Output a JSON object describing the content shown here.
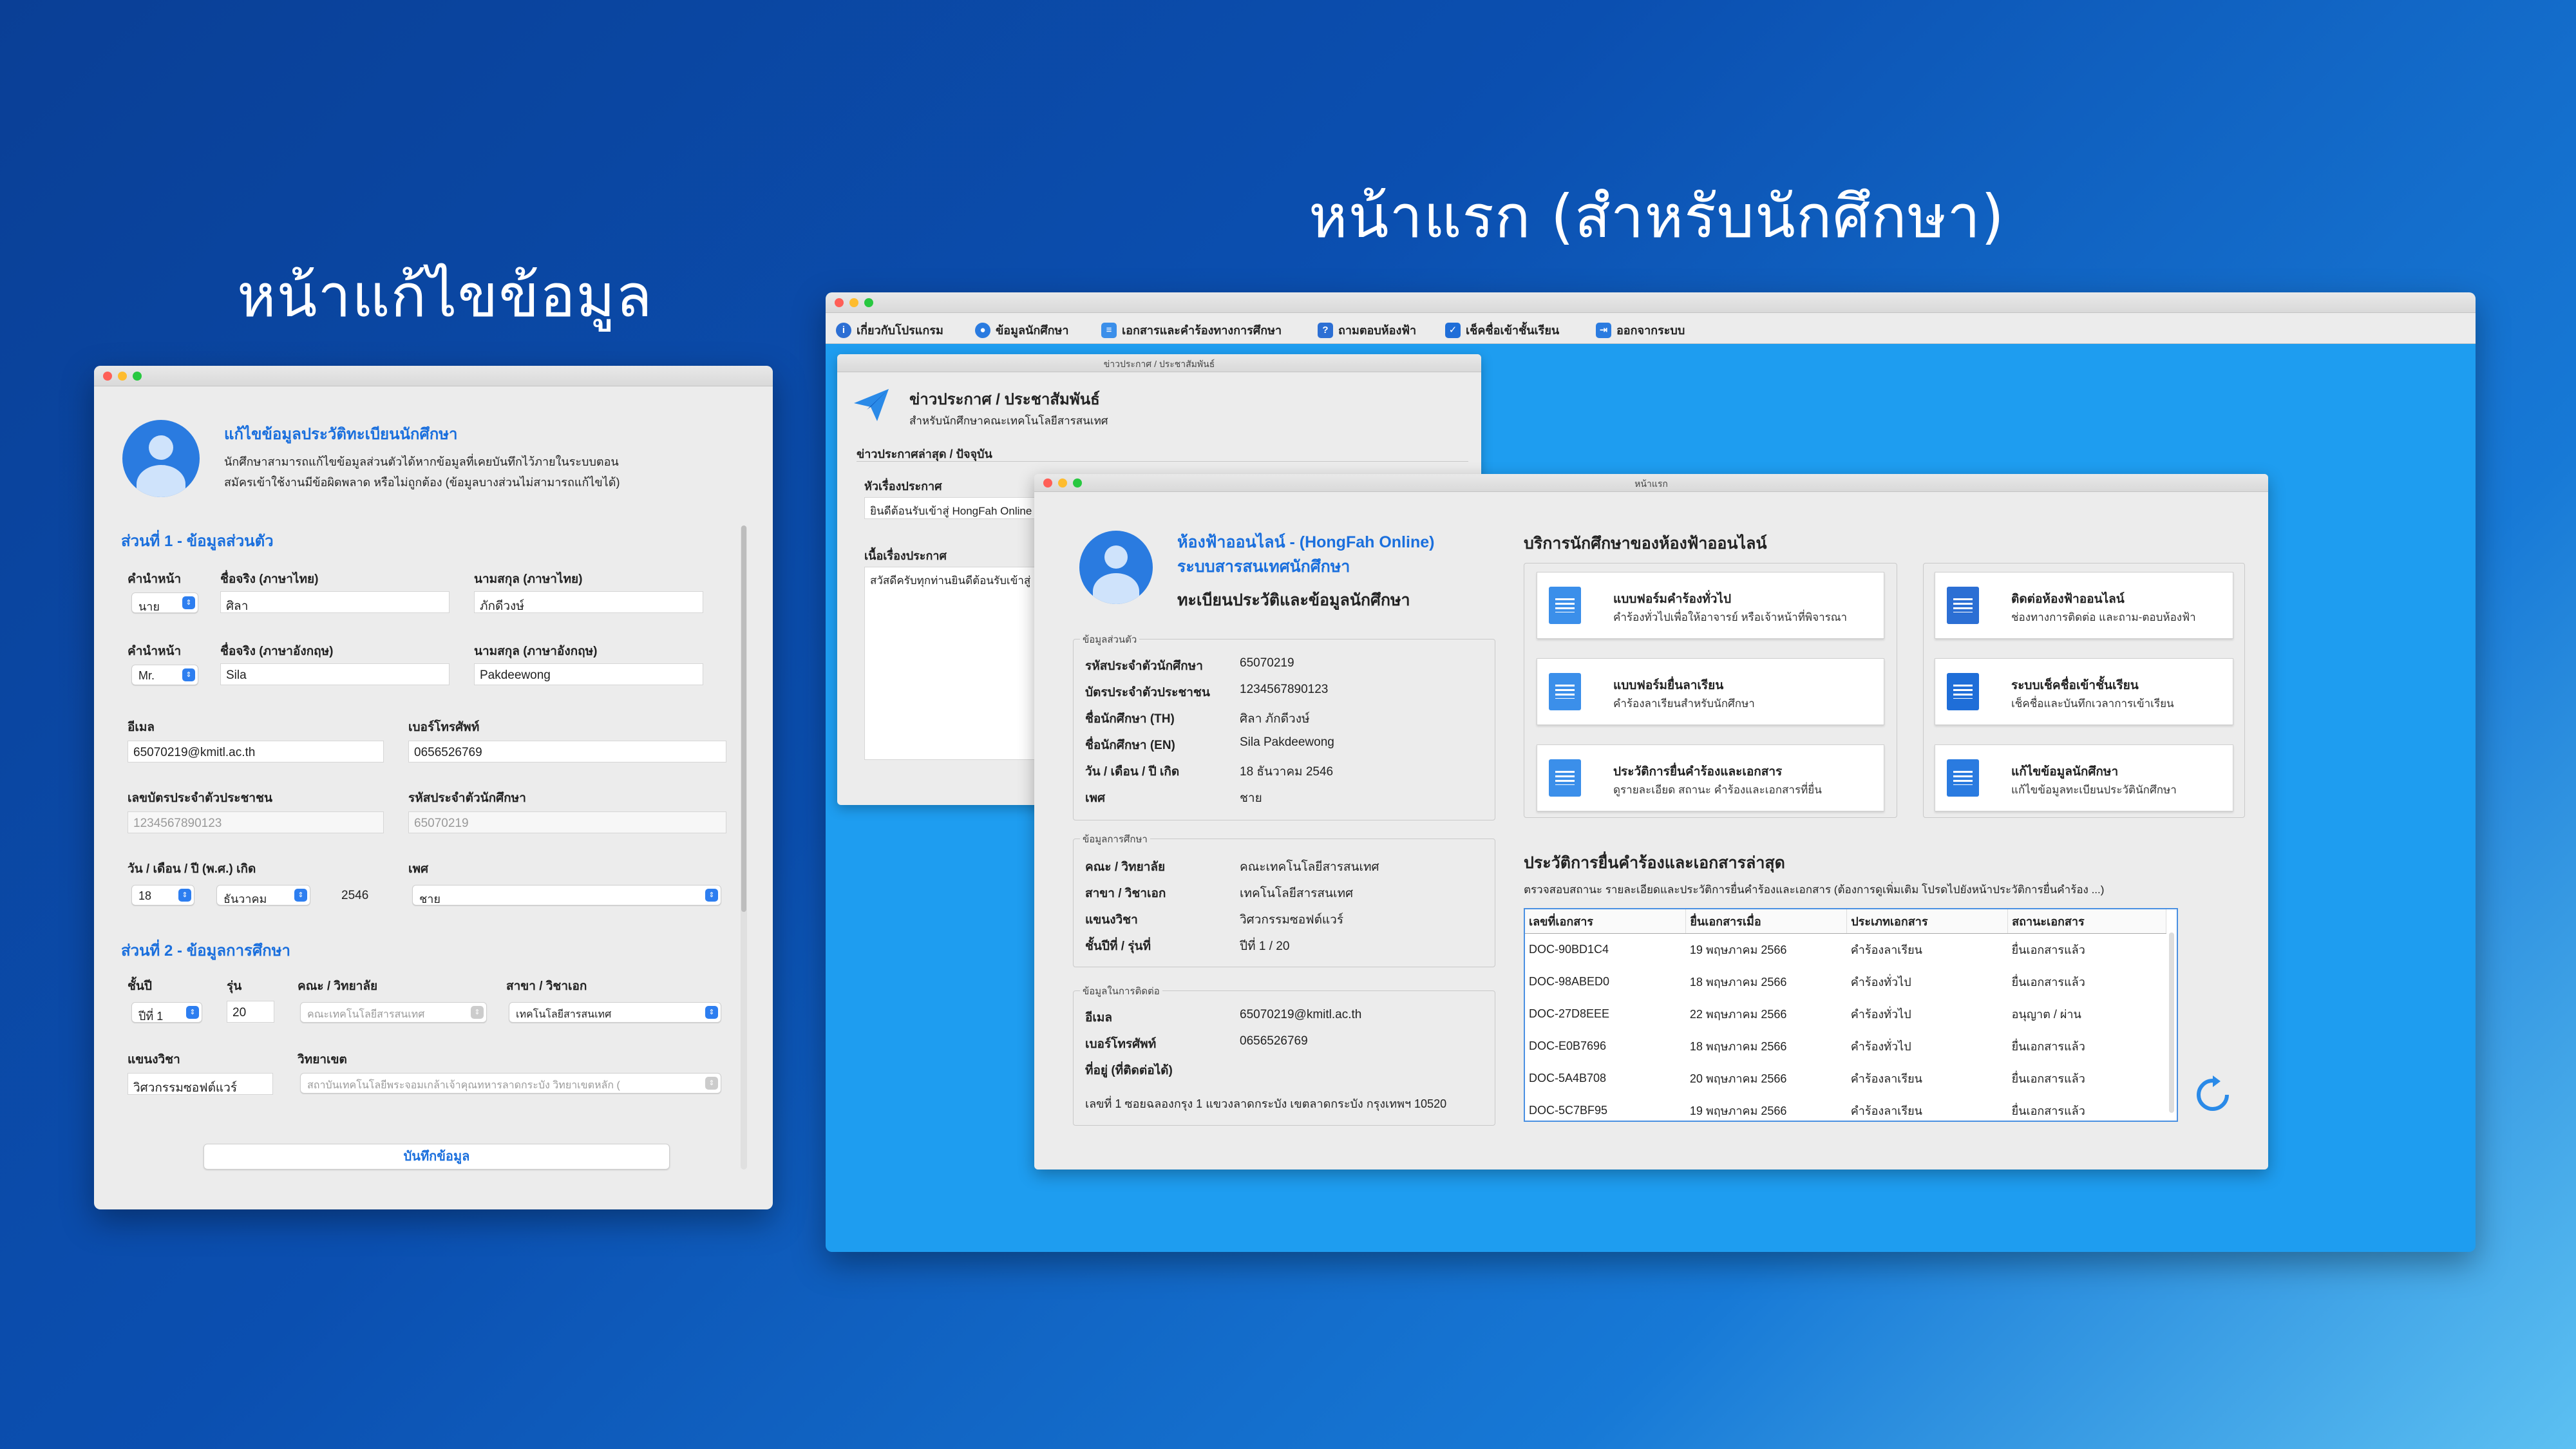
{
  "headings": {
    "edit": "หน้าแก้ไขข้อมูล",
    "home": "หน้าแรก (สำหรับนักศึกษา)"
  },
  "edit": {
    "title": "แก้ไขข้อมูลประวัติทะเบียนนักศึกษา",
    "desc1": "นักศึกษาสามารถแก้ไขข้อมูลส่วนตัวได้หากข้อมูลที่เคยบันทึกไว้ภายในระบบตอน",
    "desc2": "สมัครเข้าใช้งานมีข้อผิดพลาด หรือไม่ถูกต้อง (ข้อมูลบางส่วนไม่สามารถแก้ไขได้)",
    "sec1": "ส่วนที่ 1 - ข้อมูลส่วนตัว",
    "prefix_th_label": "คำนำหน้า",
    "prefix_th": "นาย",
    "fname_th_label": "ชื่อจริง (ภาษาไทย)",
    "fname_th": "ศิลา",
    "lname_th_label": "นามสกุล (ภาษาไทย)",
    "lname_th": "ภักดีวงษ์",
    "prefix_en_label": "คำนำหน้า",
    "prefix_en": "Mr.",
    "fname_en_label": "ชื่อจริง (ภาษาอังกฤษ)",
    "fname_en": "Sila",
    "lname_en_label": "นามสกุล (ภาษาอังกฤษ)",
    "lname_en": "Pakdeewong",
    "email_label": "อีเมล",
    "email": "65070219@kmitl.ac.th",
    "phone_label": "เบอร์โทรศัพท์",
    "phone": "0656526769",
    "citizen_label": "เลขบัตรประจำตัวประชาชน",
    "citizen": "1234567890123",
    "sid_label": "รหัสประจำตัวนักศึกษา",
    "sid": "65070219",
    "dob_label": "วัน / เดือน / ปี (พ.ศ.) เกิด",
    "dob_day": "18",
    "dob_month": "ธันวาคม",
    "dob_year": "2546",
    "gender_label": "เพศ",
    "gender": "ชาย",
    "sec2": "ส่วนที่ 2 - ข้อมูลการศึกษา",
    "year_label": "ชั้นปี",
    "year": "ปีที่ 1",
    "gen_label": "รุ่น",
    "gen": "20",
    "faculty_label": "คณะ / วิทยาลัย",
    "faculty": "คณะเทคโนโลยีสารสนเทศ",
    "major_label": "สาขา / วิชาเอก",
    "major": "เทคโนโลยีสารสนเทศ",
    "track_label": "แขนงวิชา",
    "track": "วิศวกรรมซอฟต์แวร์",
    "campus_label": "วิทยาเขต",
    "campus": "สถาบันเทคโนโลยีพระจอมเกล้าเจ้าคุณทหารลาดกระบัง วิทยาเขตหลัก (",
    "save": "บันทึกข้อมูล"
  },
  "main": {
    "menu": [
      "เกี่ยวกับโปรแกรม",
      "ข้อมูลนักศึกษา",
      "เอกสารและคำร้องทางการศึกษา",
      "ถามตอบห้องฟ้า",
      "เช็คชื่อเข้าชั้นเรียน",
      "ออกจากระบบ"
    ],
    "news": {
      "wtitle": "ข่าวประกาศ / ประชาสัมพันธ์",
      "title": "ข่าวประกาศ / ประชาสัมพันธ์",
      "sub": "สำหรับนักศึกษาคณะเทคโนโลยีสารสนเทศ",
      "latest": "ข่าวประกาศล่าสุด / ปัจจุบัน",
      "topic_label": "หัวเรื่องประกาศ",
      "topic": "ยินดีต้อนรับเข้าสู่ HongFah Online",
      "body_label": "เนื้อเรื่องประกาศ",
      "body": "สวัสดีครับทุกท่านยินดีต้อนรับเข้าสู่"
    },
    "home": {
      "wtitle": "หน้าแรก",
      "app1": "ห้องฟ้าออนไลน์ - (HongFah Online)",
      "app2": "ระบบสารสนเทศนักศึกษา",
      "app3": "ทะเบียนประวัติและข้อมูลนักศึกษา",
      "personal_cap": "ข้อมูลส่วนตัว",
      "personal": [
        {
          "k": "รหัสประจำตัวนักศึกษา",
          "v": "65070219"
        },
        {
          "k": "บัตรประจำตัวประชาชน",
          "v": "1234567890123"
        },
        {
          "k": "ชื่อนักศึกษา (TH)",
          "v": "ศิลา ภักดีวงษ์"
        },
        {
          "k": "ชื่อนักศึกษา (EN)",
          "v": "Sila Pakdeewong"
        },
        {
          "k": "วัน / เดือน / ปี เกิด",
          "v": "18 ธันวาคม 2546"
        },
        {
          "k": "เพศ",
          "v": "ชาย"
        }
      ],
      "edu_cap": "ข้อมูลการศึกษา",
      "edu": [
        {
          "k": "คณะ / วิทยาลัย",
          "v": "คณะเทคโนโลยีสารสนเทศ"
        },
        {
          "k": "สาขา / วิชาเอก",
          "v": "เทคโนโลยีสารสนเทศ"
        },
        {
          "k": "แขนงวิชา",
          "v": "วิศวกรรมซอฟต์แวร์"
        },
        {
          "k": "ชั้นปีที่ / รุ่นที่",
          "v": "ปีที่ 1 / 20"
        }
      ],
      "contact_cap": "ข้อมูลในการติดต่อ",
      "contact": [
        {
          "k": "อีเมล",
          "v": "65070219@kmitl.ac.th"
        },
        {
          "k": "เบอร์โทรศัพท์",
          "v": "0656526769"
        },
        {
          "k": "ที่อยู่ (ที่ติดต่อได้)",
          "v": ""
        }
      ],
      "address": "เลขที่ 1 ซอยฉลองกรุง 1 แขวงลาดกระบัง เขตลาดกระบัง กรุงเทพฯ 10520",
      "services_title": "บริการนักศึกษาของห้องฟ้าออนไลน์",
      "services": [
        {
          "t": "แบบฟอร์มคำร้องทั่วไป",
          "s": "คำร้องทั่วไปเพื่อให้อาจารย์ หรือเจ้าหน้าที่พิจารณา"
        },
        {
          "t": "ติดต่อห้องฟ้าออนไลน์",
          "s": "ช่องทางการติดต่อ และถาม-ตอบห้องฟ้า"
        },
        {
          "t": "แบบฟอร์มยื่นลาเรียน",
          "s": "คำร้องลาเรียนสำหรับนักศึกษา"
        },
        {
          "t": "ระบบเช็คชื่อเข้าชั้นเรียน",
          "s": "เช็คชื่อและบันทึกเวลาการเข้าเรียน"
        },
        {
          "t": "ประวัติการยื่นคำร้องและเอกสาร",
          "s": "ดูรายละเอียด สถานะ คำร้องและเอกสารที่ยื่น"
        },
        {
          "t": "แก้ไขข้อมูลนักศึกษา",
          "s": "แก้ไขข้อมูลทะเบียนประวัตินักศึกษา"
        }
      ],
      "history_title": "ประวัติการยื่นคำร้องและเอกสารล่าสุด",
      "history_desc": "ตรวจสอบสถานะ รายละเอียดและประวัติการยื่นคำร้องและเอกสาร (ต้องการดูเพิ่มเติม โปรดไปยังหน้าประวัติการยื่นคำร้อง ...)",
      "columns": [
        "เลขที่เอกสาร",
        "ยื่นเอกสารเมื่อ",
        "ประเภทเอกสาร",
        "สถานะเอกสาร"
      ],
      "rows": [
        [
          "DOC-90BD1C4",
          "19 พฤษภาคม 2566",
          "คำร้องลาเรียน",
          "ยื่นเอกสารแล้ว"
        ],
        [
          "DOC-98ABED0",
          "18 พฤษภาคม 2566",
          "คำร้องทั่วไป",
          "ยื่นเอกสารแล้ว"
        ],
        [
          "DOC-27D8EEE",
          "22 พฤษภาคม 2566",
          "คำร้องทั่วไป",
          "อนุญาต / ผ่าน"
        ],
        [
          "DOC-E0B7696",
          "18 พฤษภาคม 2566",
          "คำร้องทั่วไป",
          "ยื่นเอกสารแล้ว"
        ],
        [
          "DOC-5A4B708",
          "20 พฤษภาคม 2566",
          "คำร้องลาเรียน",
          "ยื่นเอกสารแล้ว"
        ],
        [
          "DOC-5C7BF95",
          "19 พฤษภาคม 2566",
          "คำร้องลาเรียน",
          "ยื่นเอกสารแล้ว"
        ]
      ]
    }
  }
}
